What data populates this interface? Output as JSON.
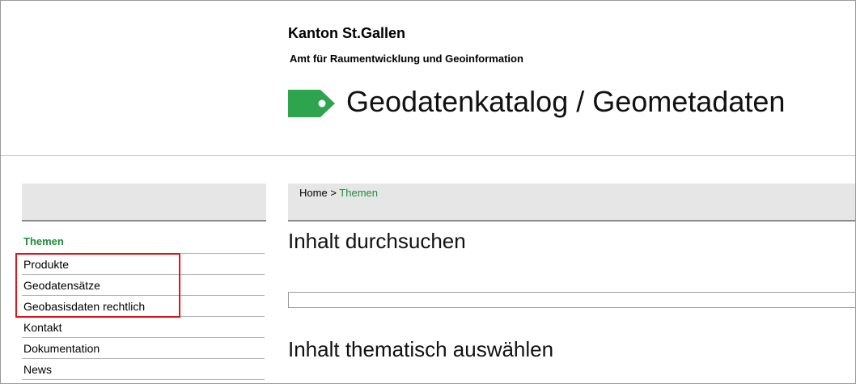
{
  "header": {
    "canton": "Kanton St.Gallen",
    "office": "Amt für Raumentwicklung und Geoinformation",
    "title": "Geodatenkatalog / Geometadaten",
    "logo_icon": "tag-icon",
    "logo_color": "#2ea44f"
  },
  "breadcrumb": {
    "home": "Home",
    "separator": ">",
    "current": "Themen"
  },
  "sidebar": {
    "heading": "Themen",
    "items": [
      {
        "label": "Produkte"
      },
      {
        "label": "Geodatensätze"
      },
      {
        "label": "Geobasisdaten rechtlich"
      },
      {
        "label": "Kontakt"
      },
      {
        "label": "Dokumentation"
      },
      {
        "label": "News"
      }
    ]
  },
  "main": {
    "search_heading": "Inhalt durchsuchen",
    "search_value": "",
    "themes_heading": "Inhalt thematisch auswählen"
  },
  "colors": {
    "accent_green": "#1e8c3a",
    "highlight_red": "#e0141c"
  }
}
